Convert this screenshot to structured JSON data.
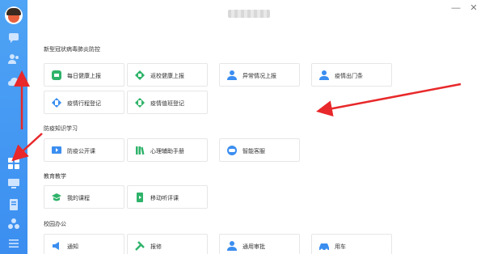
{
  "window": {
    "minimize_glyph": "—",
    "close_glyph": "✕"
  },
  "sections": [
    {
      "title": "新型冠状病毒肺炎防控",
      "items": [
        {
          "label": "每日健康上报",
          "icon": "health-report-icon",
          "color": "#2fb36a"
        },
        {
          "label": "返校健康上报",
          "icon": "return-health-icon",
          "color": "#2fb36a"
        },
        {
          "label": "异常情况上报",
          "icon": "person-alert-icon",
          "color": "#3b8ef0"
        },
        {
          "label": "疫情出门条",
          "icon": "person-pass-icon",
          "color": "#3b8ef0"
        },
        {
          "label": "疫情行程登记",
          "icon": "trip-register-icon",
          "color": "#3b8ef0"
        },
        {
          "label": "疫情值班登记",
          "icon": "duty-register-icon",
          "color": "#2fb36a"
        }
      ]
    },
    {
      "title": "防疫知识学习",
      "items": [
        {
          "label": "防疫公开课",
          "icon": "open-class-icon",
          "color": "#3b8ef0"
        },
        {
          "label": "心理辅助手册",
          "icon": "handbook-icon",
          "color": "#2fb36a"
        },
        {
          "label": "智能客服",
          "icon": "robot-service-icon",
          "color": "#3b8ef0"
        }
      ]
    },
    {
      "title": "教育教学",
      "items": [
        {
          "label": "我的课程",
          "icon": "course-icon",
          "color": "#2fb36a"
        },
        {
          "label": "移动听评课",
          "icon": "mobile-lesson-icon",
          "color": "#2fb36a"
        }
      ]
    },
    {
      "title": "校园办公",
      "items": [
        {
          "label": "通知",
          "icon": "notice-icon",
          "color": "#3b8ef0"
        },
        {
          "label": "报修",
          "icon": "repair-icon",
          "color": "#2fb36a"
        },
        {
          "label": "通用审批",
          "icon": "approval-icon",
          "color": "#3b8ef0"
        },
        {
          "label": "用车",
          "icon": "car-icon",
          "color": "#3b8ef0"
        }
      ]
    }
  ],
  "sidebar": {
    "items": [
      "chat-icon",
      "contacts-icon",
      "cloud-icon",
      "apps-icon",
      "monitor-icon",
      "document-icon",
      "group-icon",
      "menu-icon"
    ]
  },
  "colors": {
    "sidebar": "#4fa4f5",
    "arrow": "#e8282a"
  }
}
